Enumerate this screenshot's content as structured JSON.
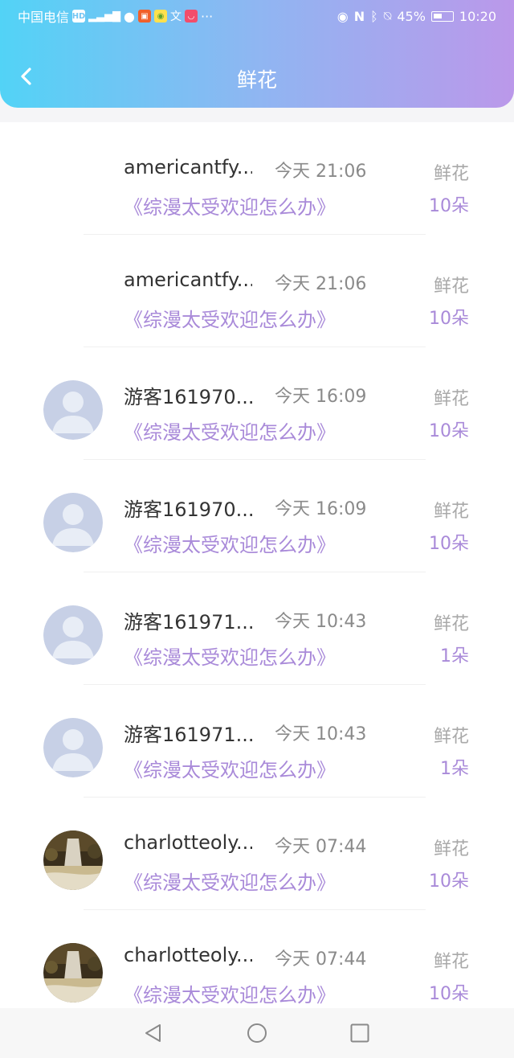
{
  "status_bar": {
    "carrier": "中国电信",
    "battery": "45%",
    "time": "10:20"
  },
  "header": {
    "title": "鲜花"
  },
  "items": [
    {
      "name": "americantfy...",
      "time": "今天 21:06",
      "novel": "《综漫太受欢迎怎么办》",
      "gift": "鲜花",
      "count": "10朵",
      "avatar": "none"
    },
    {
      "name": "americantfy...",
      "time": "今天 21:06",
      "novel": "《综漫太受欢迎怎么办》",
      "gift": "鲜花",
      "count": "10朵",
      "avatar": "none"
    },
    {
      "name": "游客161970...",
      "time": "今天 16:09",
      "novel": "《综漫太受欢迎怎么办》",
      "gift": "鲜花",
      "count": "10朵",
      "avatar": "default"
    },
    {
      "name": "游客161970...",
      "time": "今天 16:09",
      "novel": "《综漫太受欢迎怎么办》",
      "gift": "鲜花",
      "count": "10朵",
      "avatar": "default"
    },
    {
      "name": "游客161971...",
      "time": "今天 10:43",
      "novel": "《综漫太受欢迎怎么办》",
      "gift": "鲜花",
      "count": "1朵",
      "avatar": "default"
    },
    {
      "name": "游客161971...",
      "time": "今天 10:43",
      "novel": "《综漫太受欢迎怎么办》",
      "gift": "鲜花",
      "count": "1朵",
      "avatar": "default"
    },
    {
      "name": "charlotteoly...",
      "time": "今天 07:44",
      "novel": "《综漫太受欢迎怎么办》",
      "gift": "鲜花",
      "count": "10朵",
      "avatar": "photo"
    },
    {
      "name": "charlotteoly...",
      "time": "今天 07:44",
      "novel": "《综漫太受欢迎怎么办》",
      "gift": "鲜花",
      "count": "10朵",
      "avatar": "photo"
    }
  ],
  "colors": {
    "accent": "#a98ad9",
    "header_start": "#52d3f6",
    "header_end": "#bb98ea"
  },
  "icons": [
    "back-arrow-icon",
    "eye-icon",
    "nfc-icon",
    "bluetooth-icon",
    "mute-bell-icon",
    "battery-icon",
    "nav-back-icon",
    "nav-home-icon",
    "nav-recents-icon"
  ]
}
